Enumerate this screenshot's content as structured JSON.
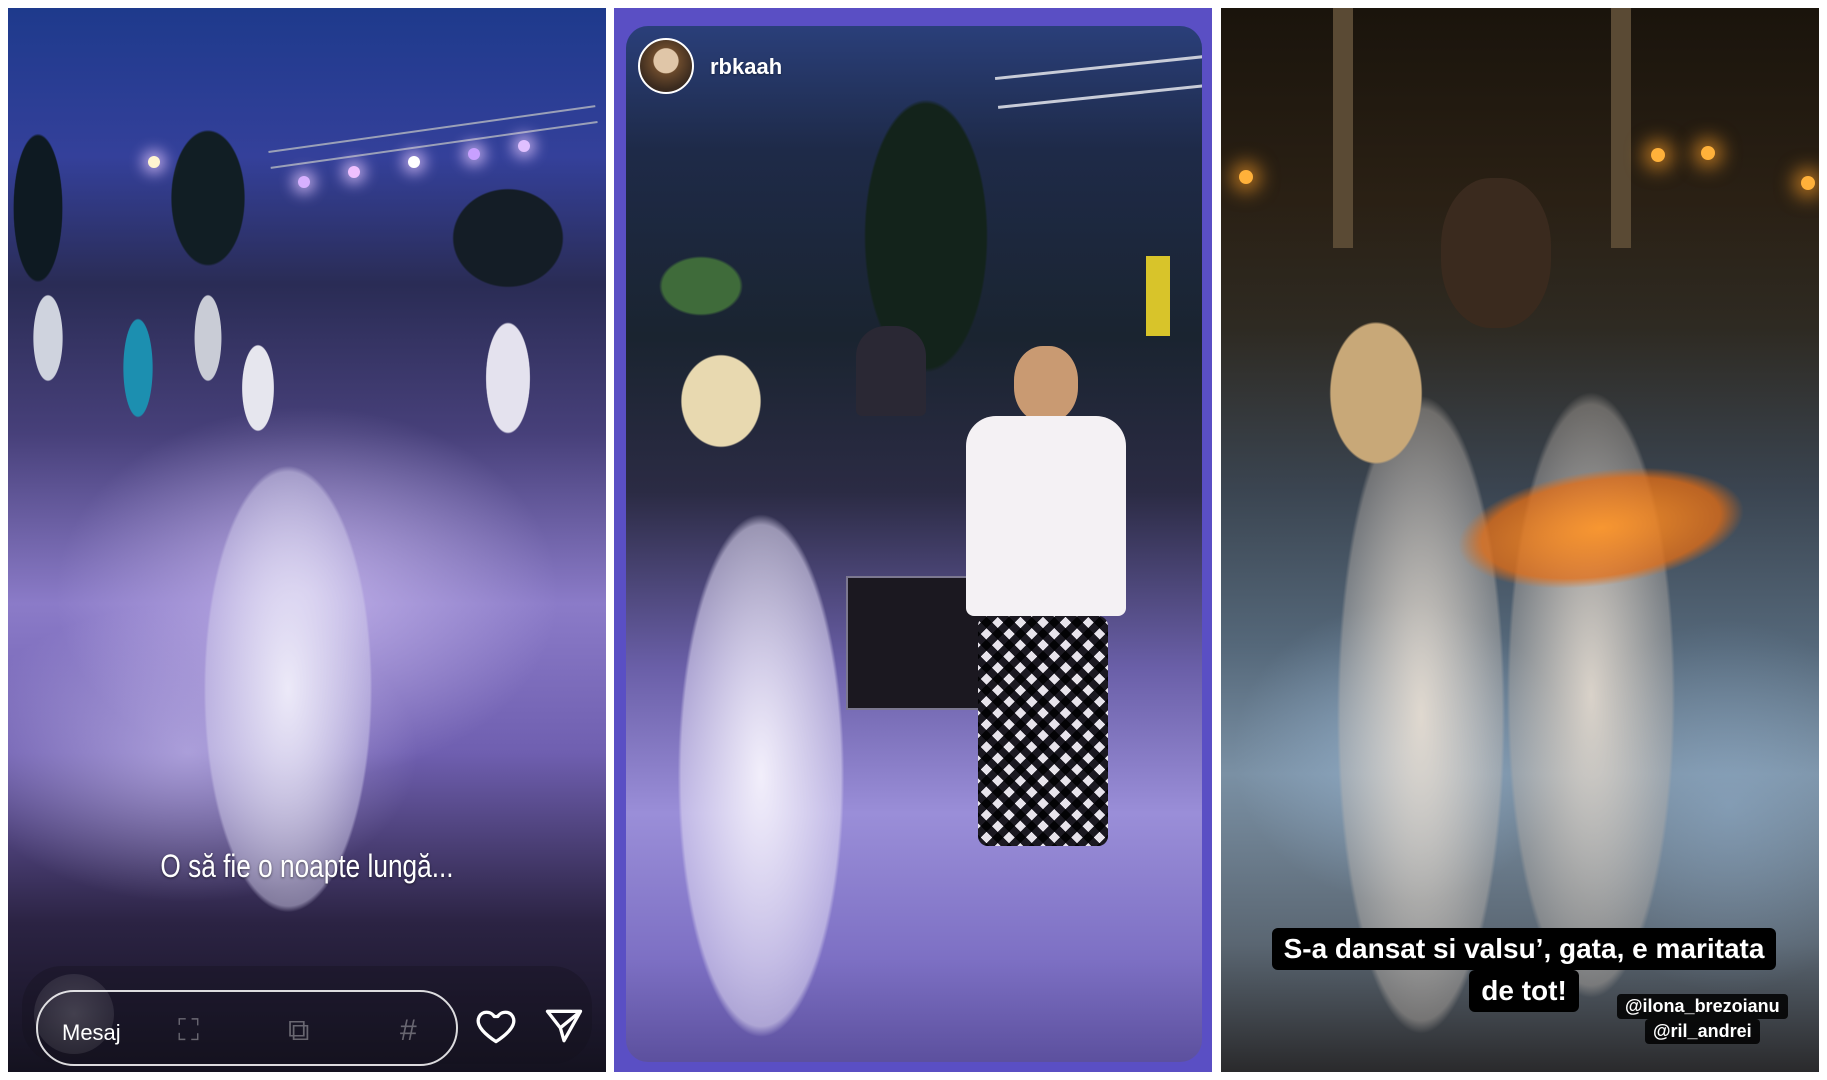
{
  "stories": [
    {
      "caption": "O să fie o noapte lungă...",
      "reply_bar": {
        "placeholder": "Mesaj",
        "icons": [
          "heart-icon",
          "send-icon"
        ]
      }
    },
    {
      "username": "rbkaah"
    },
    {
      "caption_line_1": "S-a dansat si valsu’, gata, e maritata",
      "caption_line_2": "de tot!",
      "mentions": [
        "@ilona_brezoianu",
        "@ril_andrei"
      ]
    }
  ],
  "colors": {
    "panel_2_border": "#5a4fc4",
    "caption_bg": "#000000",
    "text": "#ffffff"
  }
}
